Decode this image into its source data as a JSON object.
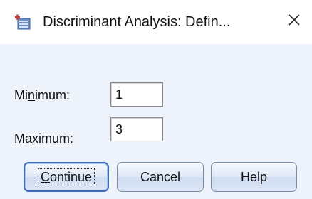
{
  "window": {
    "title": "Discriminant Analysis: Defin..."
  },
  "fields": {
    "minimum": {
      "label_mnemonic_pre": "Mi",
      "label_mnemonic": "n",
      "label_mnemonic_post": "imum:",
      "value": "1"
    },
    "maximum": {
      "label_mnemonic_pre": "Ma",
      "label_mnemonic": "x",
      "label_mnemonic_post": "imum:",
      "value": "3"
    }
  },
  "buttons": {
    "continue": {
      "mnemonic": "C",
      "rest": "ontinue"
    },
    "cancel": {
      "label": "Cancel"
    },
    "help": {
      "label": "Help"
    }
  },
  "icons": {
    "app": "spss-analysis-icon",
    "close": "close-icon"
  },
  "colors": {
    "client_background": "#eef3fb",
    "default_button_border": "#3c6cb9"
  }
}
